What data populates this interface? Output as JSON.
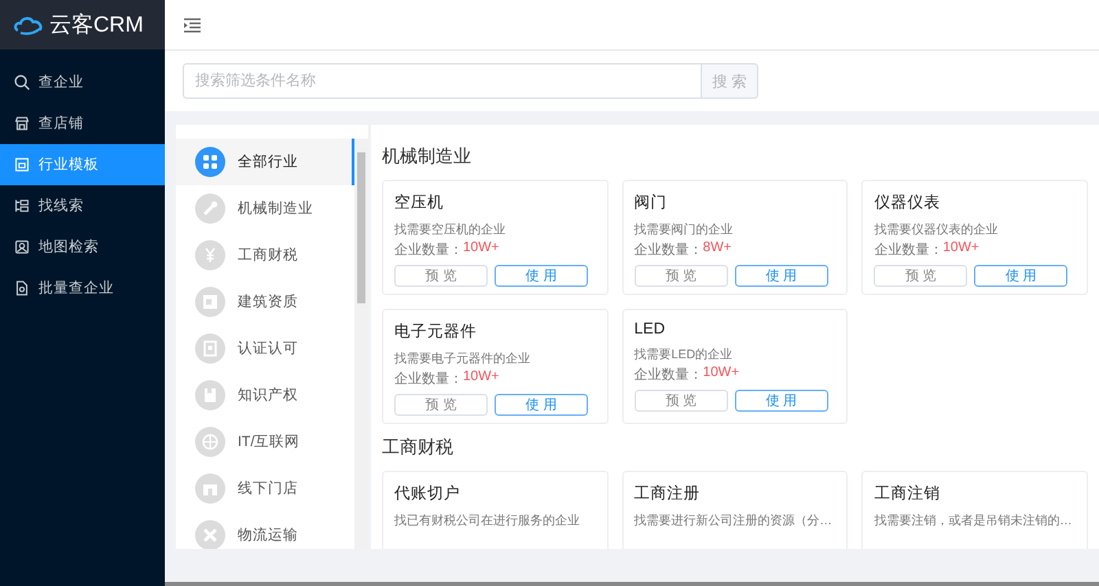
{
  "logo": {
    "text": "云客CRM"
  },
  "sidebar": {
    "items": [
      {
        "label": "查企业",
        "selected": false
      },
      {
        "label": "查店铺",
        "selected": false
      },
      {
        "label": "行业模板",
        "selected": true
      },
      {
        "label": "找线索",
        "selected": false
      },
      {
        "label": "地图检索",
        "selected": false
      },
      {
        "label": "批量查企业",
        "selected": false
      }
    ]
  },
  "search": {
    "placeholder": "搜索筛选条件名称",
    "button": "搜 索"
  },
  "categories": [
    {
      "label": "全部行业",
      "selected": true
    },
    {
      "label": "机械制造业",
      "selected": false
    },
    {
      "label": "工商财税",
      "selected": false
    },
    {
      "label": "建筑资质",
      "selected": false
    },
    {
      "label": "认证认可",
      "selected": false
    },
    {
      "label": "知识产权",
      "selected": false
    },
    {
      "label": "IT/互联网",
      "selected": false
    },
    {
      "label": "线下门店",
      "selected": false
    },
    {
      "label": "物流运输",
      "selected": false
    }
  ],
  "sections": [
    {
      "title": "机械制造业",
      "cards": [
        {
          "title": "空压机",
          "description": "找需要空压机的企业",
          "count_label": "企业数量：",
          "count": "10W+",
          "preview": "预 览",
          "use": "使 用"
        },
        {
          "title": "阀门",
          "description": "找需要阀门的企业",
          "count_label": "企业数量：",
          "count": "8W+",
          "preview": "预 览",
          "use": "使 用"
        },
        {
          "title": "仪器仪表",
          "description": "找需要仪器仪表的企业",
          "count_label": "企业数量：",
          "count": "10W+",
          "preview": "预 览",
          "use": "使 用"
        },
        {
          "title": "电子元器件",
          "description": "找需要电子元器件的企业",
          "count_label": "企业数量：",
          "count": "10W+",
          "preview": "预 览",
          "use": "使 用"
        },
        {
          "title": "LED",
          "description": "找需要LED的企业",
          "count_label": "企业数量：",
          "count": "10W+",
          "preview": "预 览",
          "use": "使 用"
        }
      ]
    },
    {
      "title": "工商财税",
      "cards": [
        {
          "title": "代账切户",
          "description": "找已有财税公司在进行服务的企业"
        },
        {
          "title": "工商注册",
          "description": "找需要进行新公司注册的资源（分…"
        },
        {
          "title": "工商注销",
          "description": "找需要注销，或者是吊销未注销的…"
        }
      ]
    }
  ]
}
